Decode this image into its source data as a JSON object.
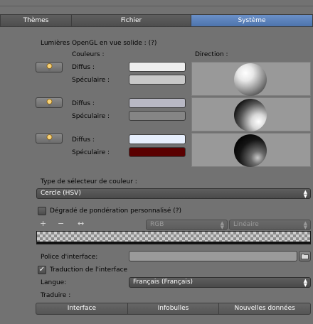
{
  "tabs": [
    {
      "label": "Thèmes",
      "active": false
    },
    {
      "label": "Fichier",
      "active": false
    },
    {
      "label": "Système",
      "active": true
    }
  ],
  "opengl": {
    "title": "Lumières OpenGL en vue solide : (?)",
    "colors_header": "Couleurs :",
    "direction_header": "Direction :",
    "lights": [
      {
        "diffuse_label": "Diffus :",
        "specular_label": "Spéculaire :",
        "diffuse_color": "#eeeeee",
        "specular_color": "#c8c8c8"
      },
      {
        "diffuse_label": "Diffus :",
        "specular_label": "Spéculaire :",
        "diffuse_color": "#b8b8c4",
        "specular_color": "#858585"
      },
      {
        "diffuse_label": "Diffus :",
        "specular_label": "Spéculaire :",
        "diffuse_color": "#e6eefc",
        "specular_color": "#5a0000"
      }
    ]
  },
  "color_picker": {
    "label": "Type de sélecteur de couleur :",
    "value": "Cercle (HSV)"
  },
  "weight_ramp": {
    "checkbox_label": "Dégradé de pondération personnalisé (?)",
    "checked": false,
    "add_symbol": "+",
    "remove_symbol": "−",
    "flip_symbol": "↔",
    "color_mode": "RGB",
    "interpolation": "Linéaire"
  },
  "interface_font": {
    "label": "Police d'interface:",
    "value": ""
  },
  "translation": {
    "checkbox_label": "Traduction de l'interface",
    "checked": true,
    "language_label": "Langue:",
    "language_value": "Français (Français)",
    "translate_label": "Traduire :",
    "buttons": [
      "Interface",
      "Infobulles",
      "Nouvelles données"
    ]
  }
}
